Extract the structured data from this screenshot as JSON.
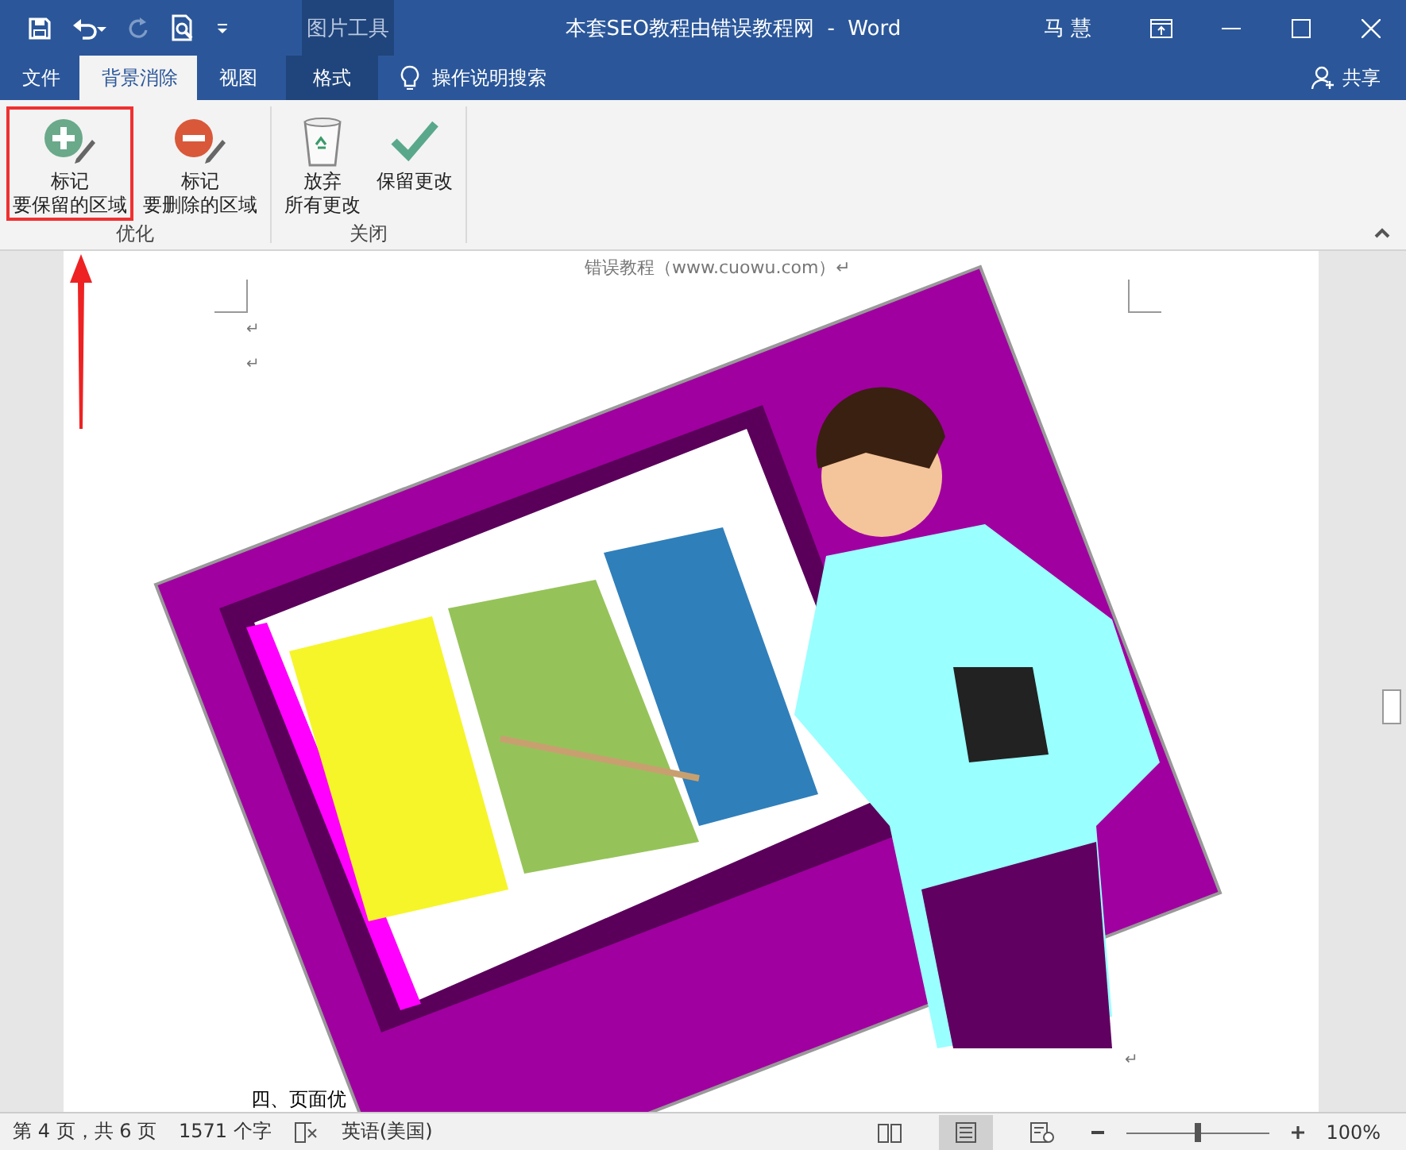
{
  "quick_access": [
    {
      "kind": "save",
      "disabled": false
    },
    {
      "kind": "undo",
      "disabled": false
    },
    {
      "kind": "redo",
      "disabled": true
    },
    {
      "kind": "preview",
      "disabled": false
    },
    {
      "kind": "customize",
      "disabled": false
    }
  ],
  "window": {
    "context_group": "图片工具",
    "title": "本套SEO教程由错误教程网  -  Word",
    "user": "马 慧"
  },
  "tabs": [
    {
      "label": "文件",
      "selected": false,
      "contextual": false
    },
    {
      "label": "背景消除",
      "selected": true,
      "contextual": false
    },
    {
      "label": "视图",
      "selected": false,
      "contextual": false
    },
    {
      "label": "格式",
      "selected": false,
      "contextual": true
    }
  ],
  "search": {
    "label": "操作说明搜索"
  },
  "share": {
    "label": "共享"
  },
  "ribbon": {
    "groups": [
      {
        "label": "优化",
        "buttons": [
          {
            "kind": "mark-keep",
            "lines": [
              "标记",
              "要保留的区域"
            ],
            "highlighted": true
          },
          {
            "kind": "mark-remove",
            "lines": [
              "标记",
              "要删除的区域"
            ],
            "highlighted": false
          }
        ]
      },
      {
        "label": "关闭",
        "buttons": [
          {
            "kind": "discard",
            "lines": [
              "放弃",
              "所有更改"
            ],
            "highlighted": false
          },
          {
            "kind": "keep",
            "lines": [
              "保留更改"
            ],
            "highlighted": false
          }
        ]
      }
    ]
  },
  "document": {
    "header": "错误教程（www.cuowu.com）↵",
    "marks": [
      "↵",
      "↵"
    ],
    "body_text": "四、页面优",
    "end_mark": "↵"
  },
  "status_bar": {
    "page": "第 4 页，共 6 页",
    "words": "1571 个字",
    "language": "英语(美国)",
    "views": [
      {
        "kind": "read",
        "selected": false
      },
      {
        "kind": "print",
        "selected": true
      },
      {
        "kind": "web",
        "selected": false
      }
    ],
    "zoom_slider": {
      "level": 0.5
    },
    "zoom": "100%"
  }
}
